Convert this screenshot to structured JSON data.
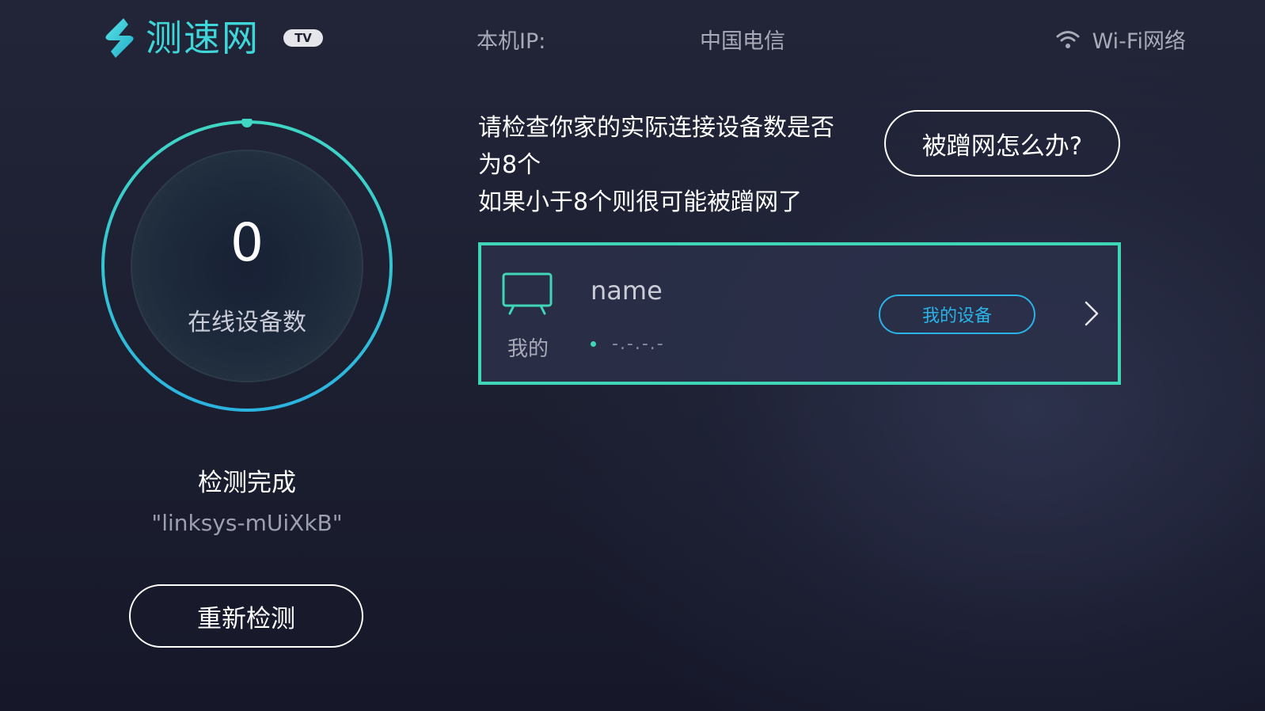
{
  "header": {
    "app_name": "测速网",
    "badge": "TV",
    "ip_label": "本机IP:",
    "isp": "中国电信",
    "network_label": "Wi-Fi网络",
    "icons": [
      "logo-icon",
      "wifi-icon"
    ]
  },
  "gauge": {
    "count": "0",
    "label": "在线设备数"
  },
  "status": {
    "title": "检测完成",
    "ssid": "\"linksys-mUiXkB\""
  },
  "retest_button": "重新检测",
  "notice": {
    "line1": "请检查你家的实际连接设备数是否",
    "line2": "为8个",
    "line3": "如果小于8个则很可能被蹭网了"
  },
  "help_button": "被蹭网怎么办?",
  "device_card": {
    "owner": "我的",
    "name": "name",
    "ip": "-.-.-.-",
    "badge": "我的设备",
    "icons": [
      "tv-icon",
      "chevron-right-icon"
    ]
  },
  "colors": {
    "accent_teal": "#3fd6d9",
    "card_border": "#3fd6b8",
    "badge_blue": "#29b3e6",
    "background": "#1f2234"
  }
}
